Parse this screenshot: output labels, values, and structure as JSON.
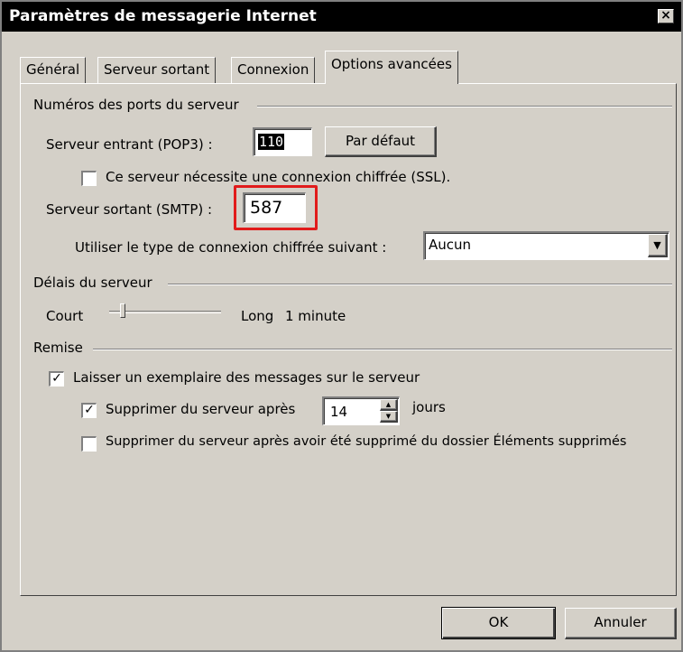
{
  "window": {
    "title": "Paramètres de messagerie Internet",
    "close_label": "×"
  },
  "tabs": [
    {
      "label": "Général"
    },
    {
      "label": "Serveur sortant"
    },
    {
      "label": "Connexion"
    },
    {
      "label": "Options avancées",
      "active": true
    }
  ],
  "ports": {
    "group_label": "Numéros des ports du serveur",
    "incoming_label": "Serveur entrant (POP3) :",
    "incoming_value": "110",
    "default_button": "Par défaut",
    "ssl_checkbox_label": "Ce serveur nécessite une connexion chiffrée (SSL).",
    "ssl_checked": false,
    "outgoing_label": "Serveur sortant (SMTP) :",
    "outgoing_value": "587",
    "encryption_label": "Utiliser le type de connexion chiffrée suivant :",
    "encryption_value": "Aucun"
  },
  "timeouts": {
    "group_label": "Délais du serveur",
    "short_label": "Court",
    "long_label": "Long",
    "value_text": "1 minute",
    "slider_level": 0.1
  },
  "delivery": {
    "group_label": "Remise",
    "leave_copy_label": "Laisser un exemplaire des messages sur le serveur",
    "leave_copy_checked": true,
    "remove_after_label": "Supprimer du serveur après",
    "remove_after_checked": true,
    "remove_after_value": "14",
    "days_label": "jours",
    "remove_when_deleted_label": "Supprimer du serveur après avoir été supprimé du dossier Éléments supprimés",
    "remove_when_deleted_checked": false
  },
  "footer": {
    "ok": "OK",
    "cancel": "Annuler"
  },
  "colors": {
    "highlight": "#e11b1b",
    "dialog_bg": "#d4d0c8",
    "title_bg": "#000000"
  }
}
